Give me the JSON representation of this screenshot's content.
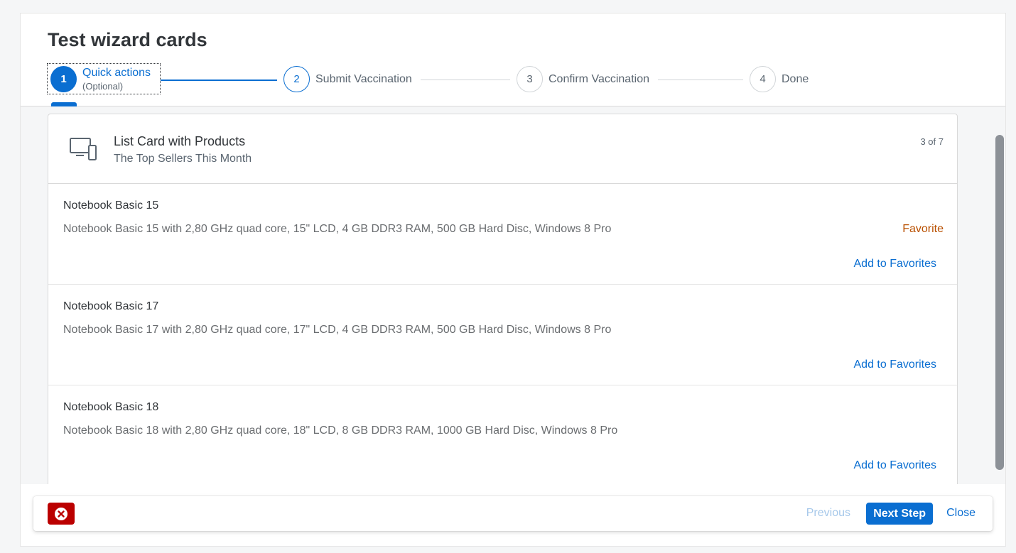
{
  "wizard": {
    "title": "Test wizard cards",
    "steps": [
      {
        "number": "1",
        "label": "Quick actions",
        "sublabel": "(Optional)"
      },
      {
        "number": "2",
        "label": "Submit Vaccination"
      },
      {
        "number": "3",
        "label": "Confirm Vaccination"
      },
      {
        "number": "4",
        "label": "Done"
      }
    ]
  },
  "card": {
    "icon": "laptop-phone-icon",
    "title": "List Card with Products",
    "subtitle": "The Top Sellers This Month",
    "count": "3 of 7",
    "items": [
      {
        "title": "Notebook Basic 15",
        "description": "Notebook Basic 15 with 2,80 GHz quad core, 15\" LCD, 4 GB DDR3 RAM, 500 GB Hard Disc, Windows 8 Pro",
        "state": "Favorite",
        "action": "Add to Favorites"
      },
      {
        "title": "Notebook Basic 17",
        "description": "Notebook Basic 17 with 2,80 GHz quad core, 17\" LCD, 4 GB DDR3 RAM, 500 GB Hard Disc, Windows 8 Pro",
        "state": "",
        "action": "Add to Favorites"
      },
      {
        "title": "Notebook Basic 18",
        "description": "Notebook Basic 18 with 2,80 GHz quad core, 18\" LCD, 8 GB DDR3 RAM, 1000 GB Hard Disc, Windows 8 Pro",
        "state": "",
        "action": "Add to Favorites"
      }
    ]
  },
  "footer": {
    "error_icon": "error-circle-icon",
    "previous_label": "Previous",
    "next_label": "Next Step",
    "close_label": "Close"
  },
  "colors": {
    "accent": "#0a6ed1",
    "favorite": "#b95000",
    "error": "#bb0000"
  }
}
